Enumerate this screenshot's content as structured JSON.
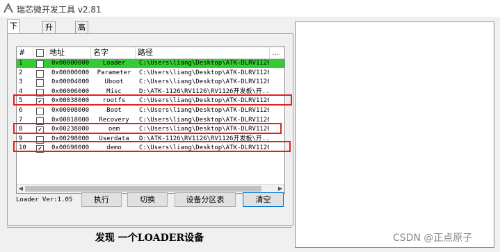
{
  "window": {
    "title": "瑞芯微开发工具 v2.81",
    "icon": "rockchip-app-icon"
  },
  "tabs": [
    {
      "label": "下载镜像"
    },
    {
      "label": "升级固件"
    },
    {
      "label": "高级功能"
    }
  ],
  "list": {
    "headers": {
      "num": "#",
      "check": "",
      "addr": "地址",
      "name": "名字",
      "path": "路径",
      "more": "..."
    },
    "rows": [
      {
        "num": "1",
        "checked": false,
        "addr": "0x00000000",
        "name": "Loader",
        "path": "C:\\Users\\liang\\Desktop\\ATK-DLRV1126...",
        "highlight": true
      },
      {
        "num": "2",
        "checked": false,
        "addr": "0x00000000",
        "name": "Parameter",
        "path": "C:\\Users\\liang\\Desktop\\ATK-DLRV1126..."
      },
      {
        "num": "3",
        "checked": false,
        "addr": "0x00004000",
        "name": "Uboot",
        "path": "C:\\Users\\liang\\Desktop\\ATK-DLRV1126..."
      },
      {
        "num": "4",
        "checked": false,
        "addr": "0x00006000",
        "name": "Misc",
        "path": "D:\\ATK-1126\\RV1126\\RV1126开发板\\开..."
      },
      {
        "num": "5",
        "checked": true,
        "addr": "0x00038000",
        "name": "rootfs",
        "path": "C:\\Users\\liang\\Desktop\\ATK-DLRV1126..."
      },
      {
        "num": "6",
        "checked": false,
        "addr": "0x00008000",
        "name": "Boot",
        "path": "C:\\Users\\liang\\Desktop\\ATK-DLRV1126..."
      },
      {
        "num": "7",
        "checked": false,
        "addr": "0x00018000",
        "name": "Recovery",
        "path": "C:\\Users\\liang\\Desktop\\ATK-DLRV1126..."
      },
      {
        "num": "8",
        "checked": true,
        "addr": "0x00238000",
        "name": "oem",
        "path": "C:\\Users\\liang\\Desktop\\ATK-DLRV1126..."
      },
      {
        "num": "9",
        "checked": false,
        "addr": "0x00298000",
        "name": "Userdata",
        "path": "D:\\ATK-1126\\RV1126\\RV1126开发板\\开..."
      },
      {
        "num": "10",
        "checked": true,
        "addr": "0x00698000",
        "name": "demo",
        "path": "C:\\Users\\liang\\Desktop\\ATK-DLRV1126..."
      }
    ]
  },
  "loader_version": "Loader Ver:1.05",
  "buttons": {
    "run": "执行",
    "switch": "切换",
    "partition_table": "设备分区表",
    "clear": "清空"
  },
  "status": "发现 一个LOADER设备",
  "watermark": "CSDN @正点原子",
  "colors": {
    "highlight_row": "#33cc33",
    "annotation_box": "#e02020"
  }
}
